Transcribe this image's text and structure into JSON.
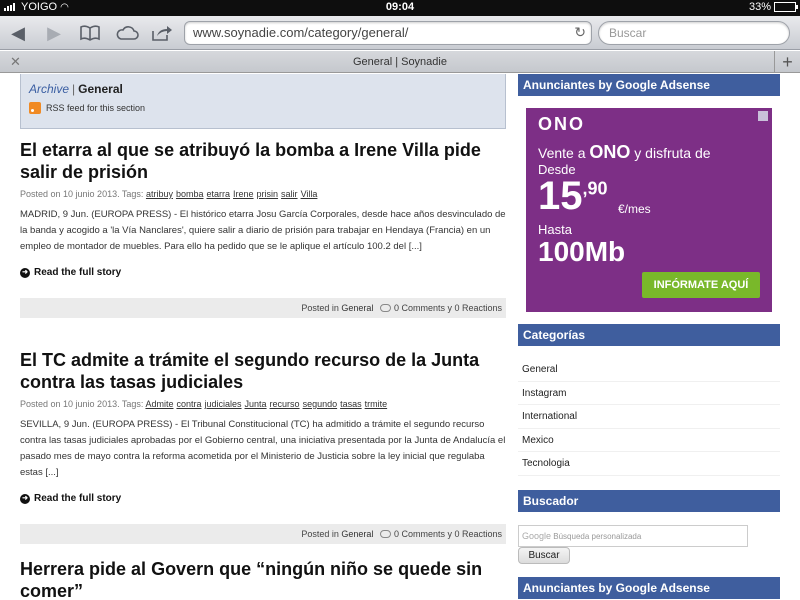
{
  "statusbar": {
    "carrier": "YOIGO",
    "time": "09:04",
    "battery": "33%",
    "battery_level": 0.33
  },
  "toolbar": {
    "url": "www.soynadie.com/category/general/",
    "search_placeholder": "Buscar"
  },
  "tab": {
    "title": "General | Soynadie"
  },
  "archive": {
    "archive_label": "Archive",
    "separator": "|",
    "current": "General",
    "rss_label": "RSS feed for this section"
  },
  "posts": [
    {
      "title": "El etarra al que se atribuyó la bomba a Irene Villa pide salir de prisión",
      "meta_prefix": "Posted on 10 junio 2013. Tags:",
      "tags": [
        "atribuy",
        "bomba",
        "etarra",
        "Irene",
        "prisin",
        "salir",
        "Villa"
      ],
      "excerpt": " MADRID, 9 Jun. (EUROPA PRESS) -    El histórico etarra Josu García Corporales, desde hace años desvinculado de la banda y acogido a 'la Vía Nanclares', quiere salir a diario de prisión para trabajar en Hendaya (Francia) en un empleo de montador de muebles. Para ello ha pedido que se le aplique el artículo 100.2 del [...]",
      "read_more": "Read the full story",
      "posted_in": "Posted in",
      "category": "General",
      "comments": "0 Comments y 0 Reactions"
    },
    {
      "title": "El TC admite a trámite el segundo recurso de la Junta contra las tasas judiciales",
      "meta_prefix": "Posted on 10 junio 2013. Tags:",
      "tags": [
        "Admite",
        "contra",
        "judiciales",
        "Junta",
        "recurso",
        "segundo",
        "tasas",
        "trmite"
      ],
      "excerpt": "SEVILLA, 9 Jun. (EUROPA PRESS) -    El Tribunal Constitucional (TC) ha admitido a trámite el segundo recurso contra las tasas judiciales aprobadas por el Gobierno central, una iniciativa presentada por la Junta de Andalucía el pasado mes de mayo contra la reforma acometida por el Ministerio de Justicia sobre la ley inicial que regulaba estas [...]",
      "read_more": "Read the full story",
      "posted_in": "Posted in",
      "category": "General",
      "comments": "0 Comments y 0 Reactions"
    },
    {
      "title": "Herrera pide al Govern que “ningún niño se quede sin comer”"
    }
  ],
  "sidebar": {
    "ads_heading": "Anunciantes by Google Adsense",
    "ad": {
      "brand": "ONO",
      "line1_prefix": "Vente a",
      "line1_brand": "ONO",
      "line1_suffix": "y disfruta de",
      "desde": "Desde",
      "price_int": "15",
      "price_dec": ",90",
      "price_unit": "€/mes",
      "hasta": "Hasta",
      "speed": "100Mb",
      "cta": "INFÓRMATE AQUÍ"
    },
    "categories_heading": "Categorías",
    "categories": [
      "General",
      "Instagram",
      "International",
      "Mexico",
      "Tecnologia"
    ],
    "buscador_heading": "Buscador",
    "search_placeholder_google": "Google",
    "search_placeholder": "Búsqueda personalizada",
    "search_button": "Buscar",
    "ads_heading_2": "Anunciantes by Google Adsense"
  }
}
